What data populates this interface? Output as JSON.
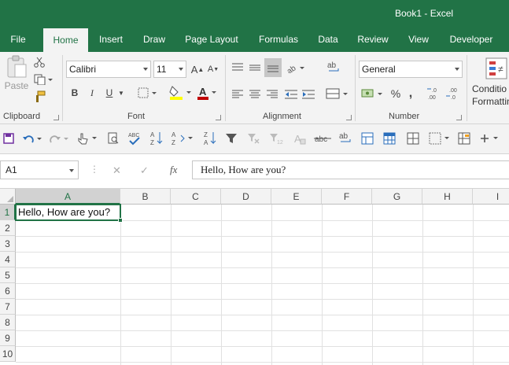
{
  "title": "Book1  -  Excel",
  "tabs": [
    "File",
    "Home",
    "Insert",
    "Draw",
    "Page Layout",
    "Formulas",
    "Data",
    "Review",
    "View",
    "Developer"
  ],
  "active_tab": "Home",
  "ribbon": {
    "clipboard": {
      "paste_label": "Paste",
      "group_label": "Clipboard"
    },
    "font": {
      "font_name": "Calibri",
      "font_size": "11",
      "bold": "B",
      "italic": "I",
      "underline": "U",
      "grow": "A",
      "shrink": "A",
      "color_letter": "A",
      "group_label": "Font"
    },
    "alignment": {
      "group_label": "Alignment"
    },
    "number": {
      "format": "General",
      "percent": "%",
      "comma": ",",
      "group_label": "Number"
    },
    "styles": {
      "conditional_label_1": "Conditio",
      "conditional_label_2": "Formattin"
    }
  },
  "formula_bar": {
    "name_box": "A1",
    "fx": "fx",
    "cancel": "✕",
    "enter": "✓",
    "content": "Hello, How are you?"
  },
  "sheet": {
    "columns": [
      "A",
      "B",
      "C",
      "D",
      "E",
      "F",
      "G",
      "H",
      "I"
    ],
    "rows": [
      "1",
      "2",
      "3",
      "4",
      "5",
      "6",
      "7",
      "8",
      "9",
      "10"
    ],
    "selected_cell": "A1",
    "cells": {
      "A1": "Hello, How are you?"
    }
  },
  "colors": {
    "accent": "#217346",
    "ribbon_bg": "#f3f3f3",
    "font_color": "#c00000",
    "highlight": "#ffff00"
  }
}
